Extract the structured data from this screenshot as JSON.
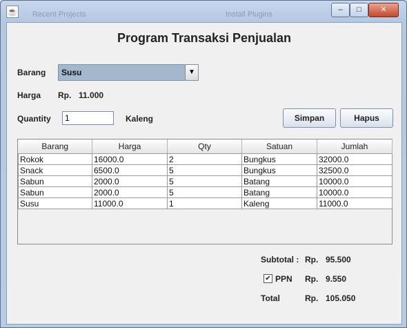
{
  "window": {
    "ghost_left": "Recent Projects",
    "ghost_right": "Install Plugins",
    "minimize": "–",
    "maximize": "□",
    "close": "✕"
  },
  "form": {
    "title": "Program Transaksi Penjualan",
    "barang_label": "Barang",
    "barang_value": "Susu",
    "harga_label": "Harga",
    "currency": "Rp.",
    "harga_value": "11.000",
    "quantity_label": "Quantity",
    "quantity_value": "1",
    "satuan_value": "Kaleng",
    "simpan_label": "Simpan",
    "hapus_label": "Hapus"
  },
  "table": {
    "headers": [
      "Barang",
      "Harga",
      "Qty",
      "Satuan",
      "Jumlah"
    ],
    "rows": [
      [
        "Rokok",
        "16000.0",
        "2",
        "Bungkus",
        "32000.0"
      ],
      [
        "Snack",
        "6500.0",
        "5",
        "Bungkus",
        "32500.0"
      ],
      [
        "Sabun",
        "2000.0",
        "5",
        "Batang",
        "10000.0"
      ],
      [
        "Sabun",
        "2000.0",
        "5",
        "Batang",
        "10000.0"
      ],
      [
        "Susu",
        "11000.0",
        "1",
        "Kaleng",
        "11000.0"
      ]
    ]
  },
  "summary": {
    "subtotal_label": "Subtotal :",
    "subtotal_currency": "Rp.",
    "subtotal_value": "95.500",
    "ppn_label": "PPN",
    "ppn_checked": true,
    "ppn_currency": "Rp.",
    "ppn_value": "9.550",
    "total_label": "Total",
    "total_currency": "Rp.",
    "total_value": "105.050"
  },
  "icons": {
    "app": "java-icon",
    "checkmark": "✔",
    "dropdown": "▼"
  }
}
